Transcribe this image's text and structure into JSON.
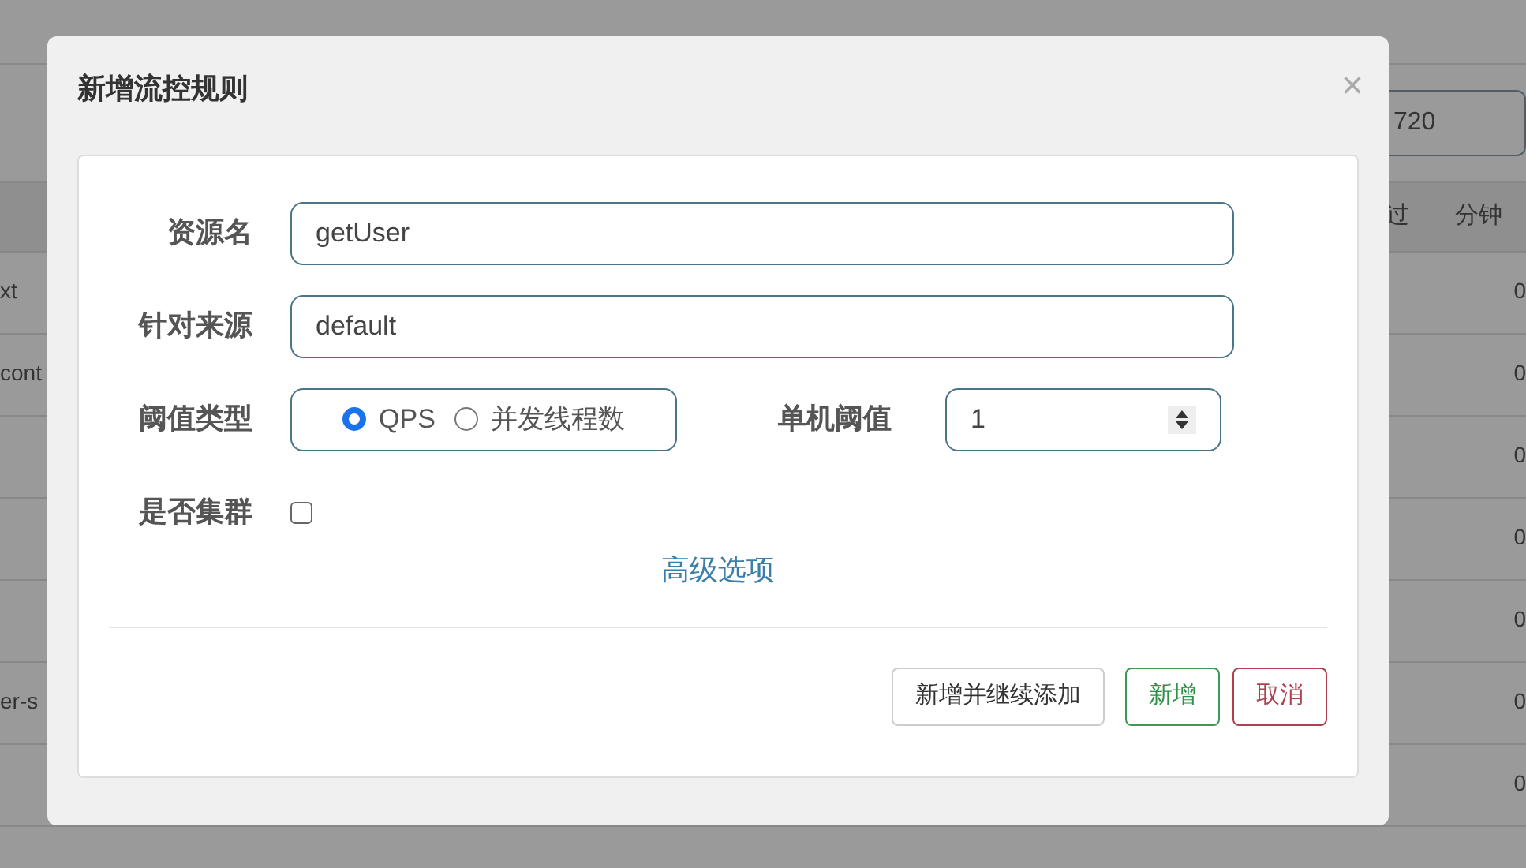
{
  "background": {
    "search_value": "720",
    "columns": [
      {
        "label": "过"
      },
      {
        "label": "分钟"
      }
    ],
    "rows": [
      {
        "name": "xt",
        "value": "0"
      },
      {
        "name": "cont",
        "value": "0"
      },
      {
        "value": "0"
      },
      {
        "value": "0"
      },
      {
        "value": "0"
      },
      {
        "name": "er-s",
        "value": "0"
      },
      {
        "value": "0"
      }
    ]
  },
  "dialog": {
    "title": "新增流控规则",
    "close": "×",
    "fields": [
      {
        "kind": "text",
        "label": "资源名",
        "value": "getUser"
      },
      {
        "kind": "text",
        "label": "针对来源",
        "value": "default"
      },
      {
        "kind": "threshold",
        "label": "阈值类型",
        "options": [
          {
            "label": "QPS",
            "selected": true
          },
          {
            "label": "并发线程数",
            "selected": false
          }
        ],
        "number_label": "单机阈值",
        "number_value": "1"
      },
      {
        "kind": "checkbox",
        "label": "是否集群",
        "checked": false
      }
    ],
    "advanced_link": "高级选项",
    "buttons": [
      {
        "kind": "default",
        "label": "新增并继续添加"
      },
      {
        "kind": "success",
        "label": "新增"
      },
      {
        "kind": "danger",
        "label": "取消"
      }
    ]
  }
}
